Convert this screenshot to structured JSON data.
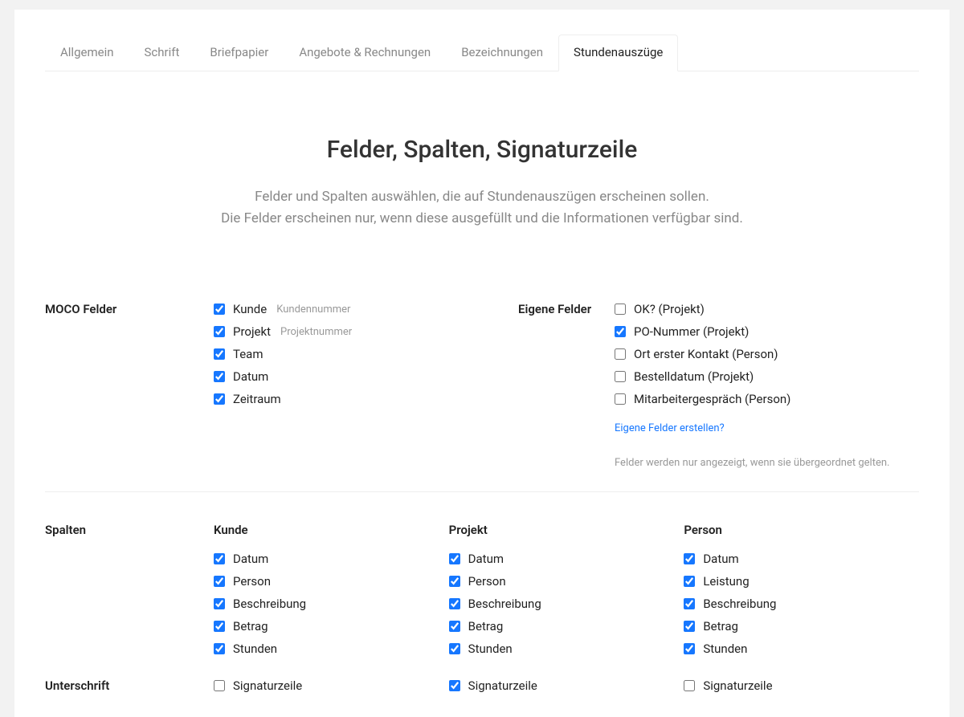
{
  "tabs": {
    "items": [
      {
        "label": "Allgemein"
      },
      {
        "label": "Schrift"
      },
      {
        "label": "Briefpapier"
      },
      {
        "label": "Angebote & Rechnungen"
      },
      {
        "label": "Bezeichnungen"
      },
      {
        "label": "Stundenauszüge"
      }
    ],
    "active_index": 5
  },
  "section": {
    "title": "Felder, Spalten, Signaturzeile",
    "desc1": "Felder und Spalten auswählen, die auf Stundenauszügen erscheinen sollen.",
    "desc2": "Die Felder erscheinen nur, wenn diese ausgefüllt und die Informationen verfügbar sind."
  },
  "moco_fields": {
    "label": "MOCO Felder",
    "items": [
      {
        "label": "Kunde",
        "sub": "Kundennummer",
        "checked": true
      },
      {
        "label": "Projekt",
        "sub": "Projektnummer",
        "checked": true
      },
      {
        "label": "Team",
        "checked": true
      },
      {
        "label": "Datum",
        "checked": true
      },
      {
        "label": "Zeitraum",
        "checked": true
      }
    ]
  },
  "own_fields": {
    "label": "Eigene Felder",
    "items": [
      {
        "label": "OK? (Projekt)",
        "checked": false
      },
      {
        "label": "PO-Nummer (Projekt)",
        "checked": true
      },
      {
        "label": "Ort erster Kontakt (Person)",
        "checked": false
      },
      {
        "label": "Bestelldatum (Projekt)",
        "checked": false
      },
      {
        "label": "Mitarbeitergespräch (Person)",
        "checked": false
      }
    ],
    "create_link": "Eigene Felder erstellen?",
    "hint": "Felder werden nur angezeigt, wenn sie übergeordnet gelten."
  },
  "columns": {
    "label": "Spalten",
    "groups": [
      {
        "title": "Kunde",
        "items": [
          {
            "label": "Datum",
            "checked": true
          },
          {
            "label": "Person",
            "checked": true
          },
          {
            "label": "Beschreibung",
            "checked": true
          },
          {
            "label": "Betrag",
            "checked": true
          },
          {
            "label": "Stunden",
            "checked": true
          }
        ],
        "signature": {
          "label": "Signaturzeile",
          "checked": false
        }
      },
      {
        "title": "Projekt",
        "items": [
          {
            "label": "Datum",
            "checked": true
          },
          {
            "label": "Person",
            "checked": true
          },
          {
            "label": "Beschreibung",
            "checked": true
          },
          {
            "label": "Betrag",
            "checked": true
          },
          {
            "label": "Stunden",
            "checked": true
          }
        ],
        "signature": {
          "label": "Signaturzeile",
          "checked": true
        }
      },
      {
        "title": "Person",
        "items": [
          {
            "label": "Datum",
            "checked": true
          },
          {
            "label": "Leistung",
            "checked": true
          },
          {
            "label": "Beschreibung",
            "checked": true
          },
          {
            "label": "Betrag",
            "checked": true
          },
          {
            "label": "Stunden",
            "checked": true
          }
        ],
        "signature": {
          "label": "Signaturzeile",
          "checked": false
        }
      }
    ]
  },
  "signature_label": "Unterschrift"
}
